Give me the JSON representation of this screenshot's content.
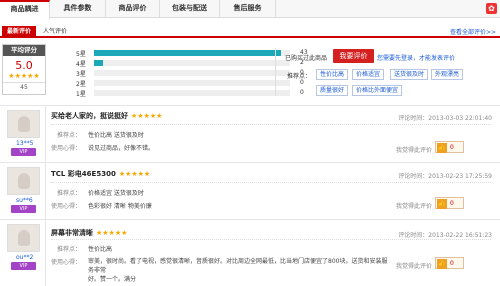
{
  "tabs": [
    "商品耦进",
    "具件参数",
    "商品评价",
    "包装与配送",
    "售后服务"
  ],
  "gift_icon": "gift-icon",
  "subtabs": [
    "最新评价",
    "人气评价"
  ],
  "view_all": "查看全部评价>>",
  "score": {
    "header": "平均评分",
    "value": "5.0",
    "stars": "★★★★★",
    "count": "45"
  },
  "distribution": [
    {
      "label": "5星",
      "count": "43",
      "fraction": 0.955
    },
    {
      "label": "4星",
      "count": "2",
      "fraction": 0.045
    },
    {
      "label": "3星",
      "count": "0",
      "fraction": 0
    },
    {
      "label": "2星",
      "count": "0",
      "fraction": 0
    },
    {
      "label": "1星",
      "count": "0",
      "fraction": 0
    }
  ],
  "bought_text": "已购买过此商品",
  "review_button": "我要评价",
  "login_text": "您需要先登录，才能发表评价",
  "rec_label": "推荐点：",
  "rec_tags": [
    "性价比高",
    "价格适宜",
    "送货很及时",
    "外观漂亮",
    "质量很好",
    "价格比外面便宜"
  ],
  "reviews": [
    {
      "user": "13**5",
      "vip": "VIP",
      "title": "买给老人家的，挺说挺好",
      "stars": "★★★★★",
      "time_label": "评论时间：",
      "time": "2013-03-03 22:01:40",
      "rec_key": "推荐点：",
      "rec_val": "性价比高 送货很及时",
      "use_key": "使用心得：",
      "use_val": "说见过商品，好像不错。",
      "helpful": "我觉得此评价",
      "count": "0"
    },
    {
      "user": "su**6",
      "vip": "VIP",
      "title": "TCL 彩电46E5300",
      "stars": "★★★★★",
      "time_label": "评论时间：",
      "time": "2013-02-23 17:25:59",
      "rec_key": "推荐点：",
      "rec_val": "价格适宜 送货很及时",
      "use_key": "使用心得：",
      "use_val": "色彩很好 清晰 物美价廉",
      "helpful": "我觉得此评价",
      "count": "0"
    },
    {
      "user": "ou**2",
      "vip": "VIP",
      "title": "屏幕非常清晰",
      "stars": "★★★★★",
      "time_label": "评论时间：",
      "time": "2013-02-22 16:51:23",
      "rec_key": "推荐点：",
      "rec_val": "性价比高",
      "use_key": "使用心得：",
      "use_val": "审美，很时尚。看了电视，感觉很清晰，音质很好。对比周边全网最低，比当地门店便宜了800块。送货和安装服务非常",
      "use_val2": "好。赞一个。满分",
      "helpful": "我觉得此评价",
      "count": "0"
    }
  ]
}
